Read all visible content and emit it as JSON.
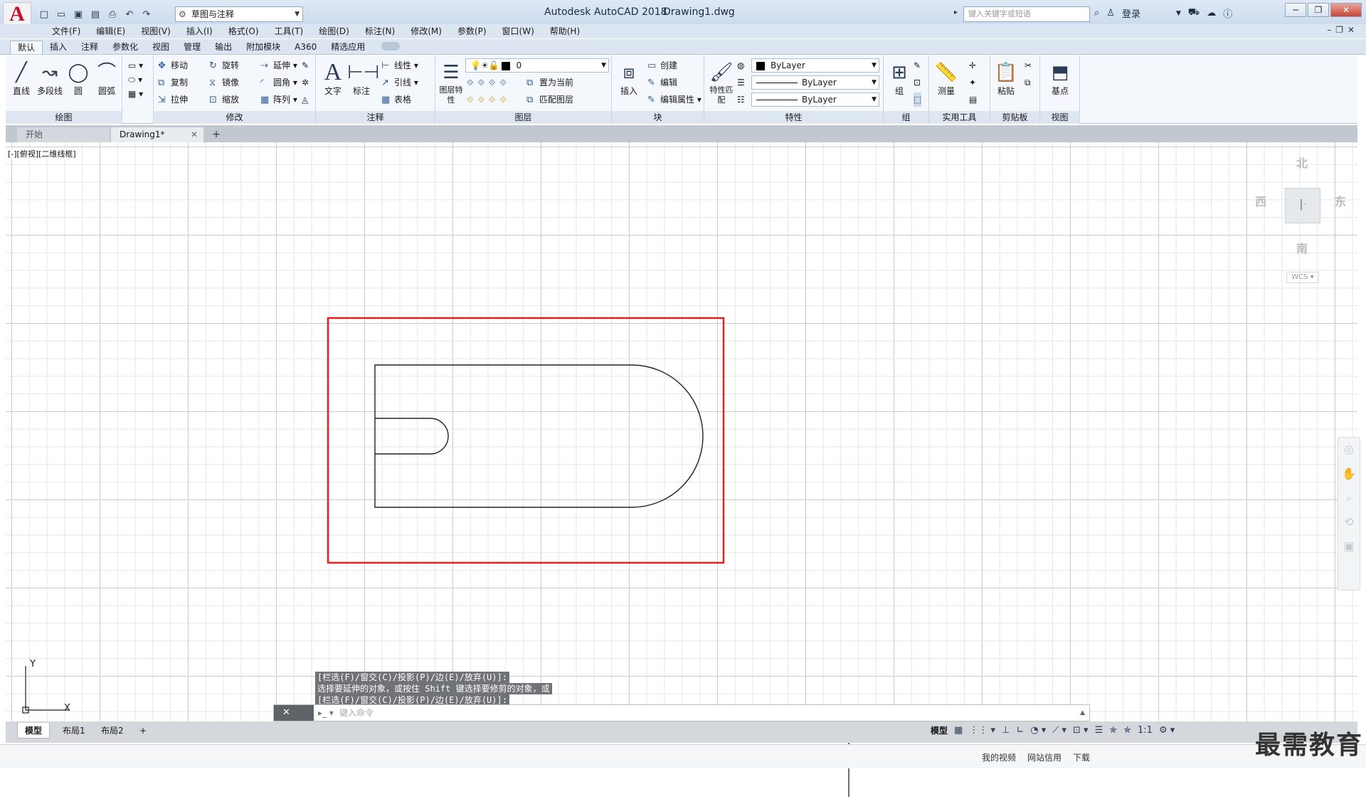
{
  "app": {
    "title": "Autodesk AutoCAD 2018",
    "file": "Drawing1.dwg",
    "logo": "A",
    "workspace": "草图与注释",
    "search_placeholder": "键入关键字或短语",
    "login": "登录"
  },
  "menu": [
    "文件(F)",
    "编辑(E)",
    "视图(V)",
    "插入(I)",
    "格式(O)",
    "工具(T)",
    "绘图(D)",
    "标注(N)",
    "修改(M)",
    "参数(P)",
    "窗口(W)",
    "帮助(H)"
  ],
  "ribbon_tabs": [
    "默认",
    "插入",
    "注释",
    "参数化",
    "视图",
    "管理",
    "输出",
    "附加模块",
    "A360",
    "精选应用"
  ],
  "ribbon": {
    "draw": {
      "title": "绘图",
      "line": "直线",
      "polyline": "多段线",
      "circle": "圆",
      "arc": "圆弧"
    },
    "modify": {
      "title": "修改",
      "move": "移动",
      "rotate": "旋转",
      "extend": "延伸",
      "copy": "复制",
      "mirror": "镜像",
      "fillet": "圆角",
      "stretch": "拉伸",
      "scale": "缩放",
      "array": "阵列"
    },
    "annotation": {
      "title": "注释",
      "text": "文字",
      "dimension": "标注",
      "linear": "线性",
      "leader": "引线",
      "table": "表格"
    },
    "layers": {
      "title": "图层",
      "layer_props": "图层特性",
      "current_layer": "0",
      "set_current": "置为当前",
      "match_layer": "匹配图层"
    },
    "block": {
      "title": "块",
      "insert": "插入",
      "create": "创建",
      "edit": "编辑",
      "edit_attr": "编辑属性"
    },
    "properties": {
      "title": "特性",
      "match": "特性匹配",
      "color": "ByLayer",
      "linetype": "ByLayer",
      "lineweight": "ByLayer"
    },
    "groups": {
      "title": "组",
      "group": "组"
    },
    "utilities": {
      "title": "实用工具",
      "measure": "测量"
    },
    "clipboard": {
      "title": "剪贴板",
      "paste": "粘贴"
    },
    "view": {
      "title": "视图",
      "base": "基点"
    }
  },
  "doc_tabs": {
    "start": "开始",
    "active": "Drawing1*"
  },
  "viewport_label": "[-][俯视][二维线框]",
  "viewcube": {
    "north": "北",
    "south": "南",
    "east": "东",
    "west": "西",
    "wcs": "WCS"
  },
  "ucs": {
    "x": "X",
    "y": "Y"
  },
  "command_history": [
    "[栏选(F)/窗交(C)/投影(P)/边(E)/放弃(U)]:",
    "选择要延伸的对象，或按住 Shift 键选择要修剪的对象，或",
    "[栏选(F)/窗交(C)/投影(P)/边(E)/放弃(U)]:"
  ],
  "command_line": {
    "placeholder": "键入命令"
  },
  "layout_tabs": [
    "模型",
    "布局1",
    "布局2"
  ],
  "status": {
    "model": "模型",
    "scale": "1:1"
  },
  "bottom": [
    "我的视频",
    "网站信用",
    "下载"
  ],
  "watermark": "最需教育",
  "colors": {
    "highlight_box": "#e0201a",
    "accent": "#c8102e"
  }
}
